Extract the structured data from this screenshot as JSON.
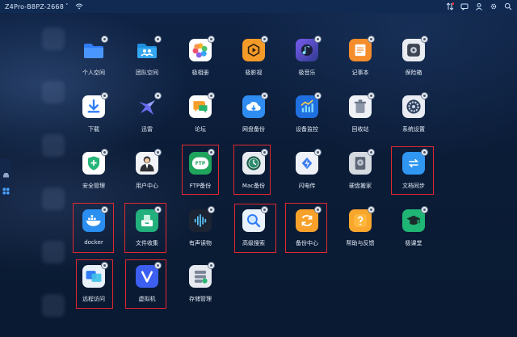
{
  "window": {
    "title": "Z4Pro-B8PZ-2668",
    "caret": "˅"
  },
  "apps": [
    {
      "label": "个人空间",
      "icon": "folder-icon"
    },
    {
      "label": "团队空间",
      "icon": "team-folder-icon"
    },
    {
      "label": "极相册",
      "icon": "photos-icon"
    },
    {
      "label": "极影视",
      "icon": "video-icon"
    },
    {
      "label": "极音乐",
      "icon": "music-icon"
    },
    {
      "label": "记事本",
      "icon": "notepad-icon"
    },
    {
      "label": "保险箱",
      "icon": "safe-icon"
    },
    {
      "label": "下载",
      "icon": "download-icon"
    },
    {
      "label": "迅雷",
      "icon": "xunlei-icon"
    },
    {
      "label": "论坛",
      "icon": "forum-icon"
    },
    {
      "label": "网盘备份",
      "icon": "cloud-backup-icon"
    },
    {
      "label": "设备监控",
      "icon": "monitor-icon"
    },
    {
      "label": "回收站",
      "icon": "trash-icon"
    },
    {
      "label": "系统设置",
      "icon": "settings-icon"
    },
    {
      "label": "安全管理",
      "icon": "security-icon"
    },
    {
      "label": "用户中心",
      "icon": "user-center-icon"
    },
    {
      "label": "FTP备份",
      "icon": "ftp-icon",
      "badge_text": "FTP"
    },
    {
      "label": "Mac备份",
      "icon": "time-machine-icon"
    },
    {
      "label": "闪电传",
      "icon": "flash-transfer-icon"
    },
    {
      "label": "硬盘搬家",
      "icon": "disk-migrate-icon"
    },
    {
      "label": "文档同步",
      "icon": "doc-sync-icon"
    },
    {
      "label": "docker",
      "icon": "docker-icon"
    },
    {
      "label": "文件收集",
      "icon": "file-collect-icon"
    },
    {
      "label": "有声读物",
      "icon": "audiobook-icon"
    },
    {
      "label": "高级搜索",
      "icon": "advanced-search-icon"
    },
    {
      "label": "备份中心",
      "icon": "backup-center-icon"
    },
    {
      "label": "帮助与反馈",
      "icon": "help-icon"
    },
    {
      "label": "极课堂",
      "icon": "classroom-icon"
    },
    {
      "label": "远程访问",
      "icon": "remote-access-icon"
    },
    {
      "label": "虚拟机",
      "icon": "virtual-machine-icon"
    },
    {
      "label": "存储管理",
      "icon": "storage-icon"
    }
  ],
  "colors": {
    "background": "#0c1e3b",
    "highlight": "#e0282e",
    "label": "#e6eef9"
  }
}
